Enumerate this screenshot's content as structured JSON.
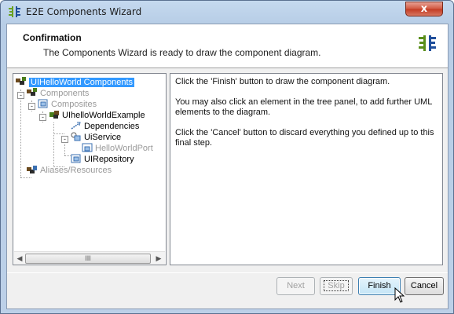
{
  "window": {
    "title": "E2E Components Wizard",
    "close_label": "x"
  },
  "header": {
    "title": "Confirmation",
    "subtitle": "The Components Wizard is ready to draw the component diagram."
  },
  "tree": {
    "root": "UIHelloWorld Components",
    "components": "Components",
    "composites": "Composites",
    "example": "UIhelloWorldExample",
    "dependencies": "Dependencies",
    "service": "UiService",
    "port": "HelloWorldPort",
    "repository": "UIRepository",
    "aliases": "Aliases/Resources",
    "scroll_grip": "III"
  },
  "instructions": {
    "finish_text": "Click the 'Finish' button to draw the component diagram.",
    "tree_text": "You may also click an element in the tree panel, to add further UML elements to the diagram.",
    "cancel_text": "Click the 'Cancel' button to discard everything you defined up to this final step."
  },
  "buttons": {
    "next": "Next",
    "skip": "Skip",
    "finish": "Finish",
    "cancel": "Cancel"
  },
  "colors": {
    "selection": "#3399ff",
    "accent_green": "#5a8f1a",
    "accent_blue": "#1f4e9b",
    "close_red": "#c33a22"
  }
}
